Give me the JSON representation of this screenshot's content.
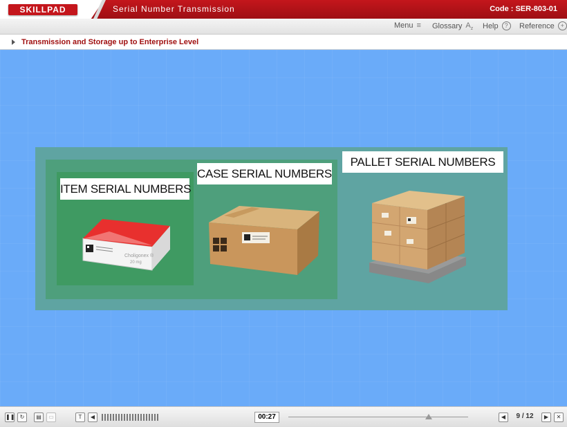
{
  "header": {
    "logo": "SKILLPAD",
    "title": "Serial Number Transmission",
    "code": "Code :  SER-803-01"
  },
  "menubar": {
    "menu_label": "Menu",
    "glossary_label": "Glossary",
    "help_label": "Help",
    "reference_label": "Reference"
  },
  "breadcrumb": {
    "text": "Transmission and Storage up to Enterprise Level"
  },
  "stage": {
    "item_label": "ITEM SERIAL NUMBERS",
    "case_label": "CASE SERIAL NUMBERS",
    "pallet_label": "PALLET SERIAL NUMBERS",
    "box_brand": "Choligonex ®",
    "box_dose": "20 mg"
  },
  "footer": {
    "timer": "00:27",
    "page_current": "9",
    "page_separator": "/",
    "page_total": "12",
    "progress_fraction": 0.78
  },
  "colors": {
    "header_red": "#c4161c",
    "stage_blue": "#6aabf9",
    "outer_panel": "#5fa4a2",
    "mid_panel": "#4e9f7c",
    "inner_panel": "#3f9a62"
  }
}
